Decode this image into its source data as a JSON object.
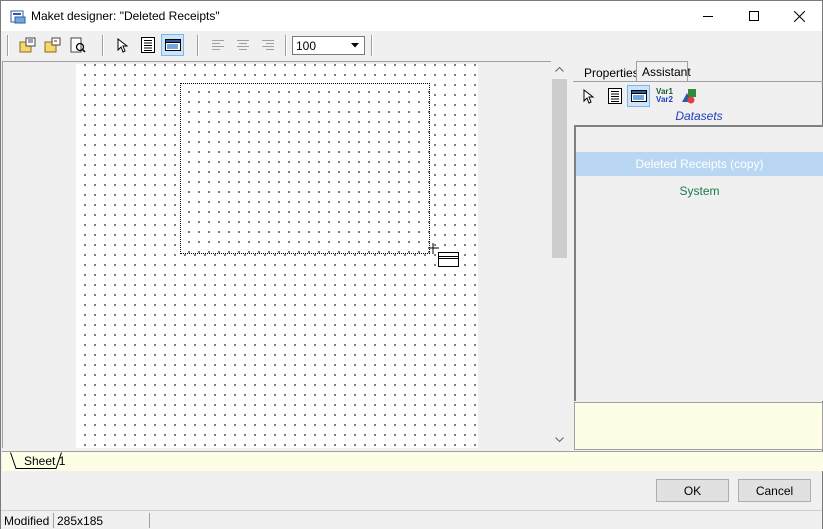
{
  "window": {
    "title": "Maket designer: \"Deleted Receipts\""
  },
  "toolbar": {
    "zoom_value": "100"
  },
  "panel": {
    "tabs": [
      {
        "label": "Properties"
      },
      {
        "label": "Assistant"
      }
    ],
    "var_label_1": "Var1",
    "var_label_2": "Var2",
    "datasets_title": "Datasets",
    "datasets": [
      {
        "label": "Deleted Receipts (copy)",
        "selected": true
      },
      {
        "label": "System",
        "selected": false
      }
    ]
  },
  "sheets": [
    {
      "label": "Sheet 1"
    }
  ],
  "buttons": {
    "ok": "OK",
    "cancel": "Cancel"
  },
  "status": {
    "state": "Modified",
    "size": "285x185"
  },
  "colors": {
    "selected_row": "#b9d7f2",
    "datasets_title": "#1f3fbf",
    "dataset_text": "#1a7a4a",
    "info_box": "#fefde6",
    "pressed_button": "#cce4f7"
  }
}
